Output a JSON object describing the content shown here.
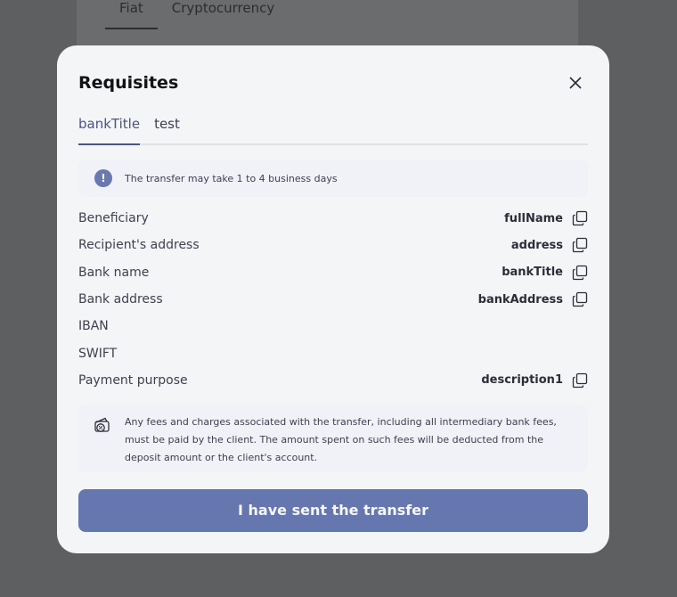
{
  "background": {
    "tabs": [
      {
        "label": "Fiat"
      },
      {
        "label": "Cryptocurrency"
      }
    ]
  },
  "modal": {
    "title": "Requisites",
    "tabs": [
      {
        "label": "bankTitle",
        "active": true
      },
      {
        "label": "test",
        "active": false
      }
    ],
    "notice": "The transfer may take 1 to 4 business days",
    "rows": [
      {
        "label": "Beneficiary",
        "value": "fullName"
      },
      {
        "label": "Recipient's address",
        "value": "address"
      },
      {
        "label": "Bank name",
        "value": "bankTitle"
      },
      {
        "label": "Bank address",
        "value": "bankAddress"
      },
      {
        "label": "IBAN",
        "value": ""
      },
      {
        "label": "SWIFT",
        "value": ""
      },
      {
        "label": "Payment purpose",
        "value": "description1"
      }
    ],
    "fees_text": "Any fees and charges associated with the transfer, including all intermediary bank fees, must be paid by the client. The amount spent on such fees will be deducted from the deposit amount or the client's account.",
    "submit_label": "I have sent the transfer"
  },
  "colors": {
    "accent": "#4a5487",
    "button": "#6676ae",
    "overlay": "#5e5f60"
  },
  "icons": {
    "close": "close-icon",
    "info": "info-icon",
    "copy": "copy-icon",
    "fees": "wallet-percent-icon"
  }
}
